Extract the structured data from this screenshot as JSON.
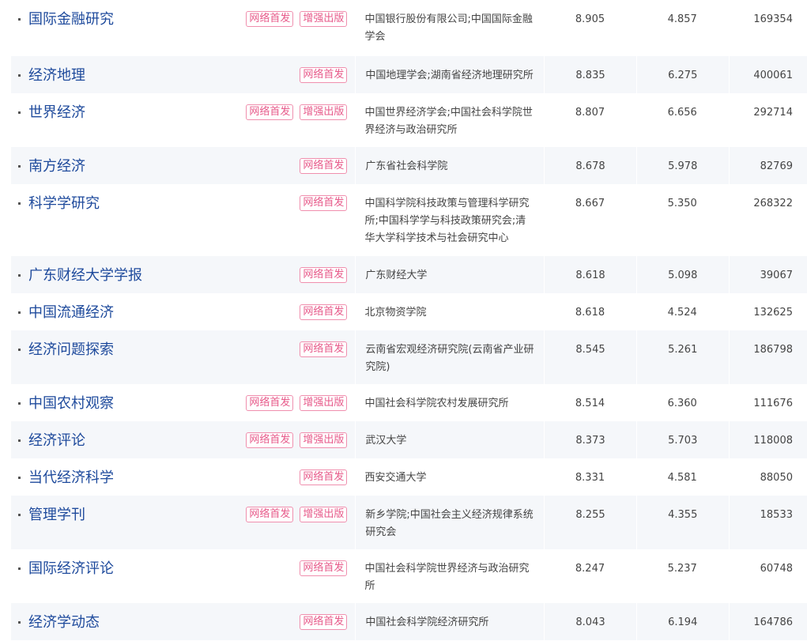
{
  "journals": [
    {
      "name": "国际金融研究",
      "tags": [
        "网络首发",
        "增强出版"
      ],
      "org": "中国银行股份有限公司;中国国际金融学会",
      "v1": "8.905",
      "v2": "4.857",
      "v3": "169354"
    },
    {
      "name": "经济地理",
      "tags": [
        "网络首发"
      ],
      "org": "中国地理学会;湖南省经济地理研究所",
      "v1": "8.835",
      "v2": "6.275",
      "v3": "400061"
    },
    {
      "name": "世界经济",
      "tags": [
        "网络首发",
        "增强出版"
      ],
      "org": "中国世界经济学会;中国社会科学院世界经济与政治研究所",
      "v1": "8.807",
      "v2": "6.656",
      "v3": "292714"
    },
    {
      "name": "南方经济",
      "tags": [
        "网络首发"
      ],
      "org": "广东省社会科学院",
      "v1": "8.678",
      "v2": "5.978",
      "v3": "82769"
    },
    {
      "name": "科学学研究",
      "tags": [
        "网络首发"
      ],
      "org": "中国科学院科技政策与管理科学研究所;中国科学学与科技政策研究会;清华大学科学技术与社会研究中心",
      "v1": "8.667",
      "v2": "5.350",
      "v3": "268322"
    },
    {
      "name": "广东财经大学学报",
      "tags": [
        "网络首发"
      ],
      "org": "广东财经大学",
      "v1": "8.618",
      "v2": "5.098",
      "v3": "39067"
    },
    {
      "name": "中国流通经济",
      "tags": [
        "网络首发"
      ],
      "org": "北京物资学院",
      "v1": "8.618",
      "v2": "4.524",
      "v3": "132625"
    },
    {
      "name": "经济问题探索",
      "tags": [
        "网络首发"
      ],
      "org": "云南省宏观经济研究院(云南省产业研究院)",
      "v1": "8.545",
      "v2": "5.261",
      "v3": "186798"
    },
    {
      "name": "中国农村观察",
      "tags": [
        "网络首发",
        "增强出版"
      ],
      "org": "中国社会科学院农村发展研究所",
      "v1": "8.514",
      "v2": "6.360",
      "v3": "111676"
    },
    {
      "name": "经济评论",
      "tags": [
        "网络首发",
        "增强出版"
      ],
      "org": "武汉大学",
      "v1": "8.373",
      "v2": "5.703",
      "v3": "118008"
    },
    {
      "name": "当代经济科学",
      "tags": [
        "网络首发"
      ],
      "org": "西安交通大学",
      "v1": "8.331",
      "v2": "4.581",
      "v3": "88050"
    },
    {
      "name": "管理学刊",
      "tags": [
        "网络首发",
        "增强出版"
      ],
      "org": "新乡学院;中国社会主义经济规律系统研究会",
      "v1": "8.255",
      "v2": "4.355",
      "v3": "18533"
    },
    {
      "name": "国际经济评论",
      "tags": [
        "网络首发"
      ],
      "org": "中国社会科学院世界经济与政治研究所",
      "v1": "8.247",
      "v2": "5.237",
      "v3": "60748"
    },
    {
      "name": "经济学动态",
      "tags": [
        "网络首发"
      ],
      "org": "中国社会科学院经济研究所",
      "v1": "8.043",
      "v2": "6.194",
      "v3": "164786"
    }
  ]
}
